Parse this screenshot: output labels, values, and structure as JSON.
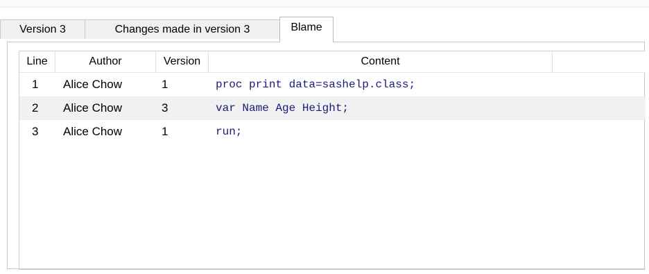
{
  "tabs": [
    {
      "label": "Version 3"
    },
    {
      "label": "Changes made in version 3"
    },
    {
      "label": "Blame"
    }
  ],
  "blame_table": {
    "columns": [
      "Line",
      "Author",
      "Version",
      "Content"
    ],
    "rows": [
      {
        "line": "1",
        "author": "Alice Chow",
        "version": "1",
        "content": "proc print data=sashelp.class;"
      },
      {
        "line": "2",
        "author": "Alice Chow",
        "version": "3",
        "content": "var Name Age Height;"
      },
      {
        "line": "3",
        "author": "Alice Chow",
        "version": "1",
        "content": "run;"
      }
    ]
  }
}
